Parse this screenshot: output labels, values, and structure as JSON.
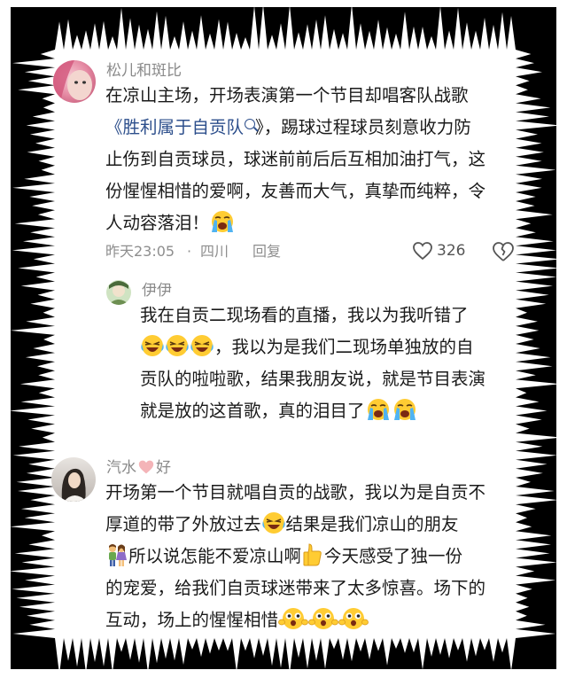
{
  "comments": [
    {
      "username": "松儿和斑比",
      "avatar": "avatar-pink-face",
      "lines": [
        [
          "在凉山主场，开场表演第一个节目却唱客队战歌"
        ],
        [
          "《胜利属于自贡队",
          "》，踢球过程球员刻意收力防"
        ],
        [
          "止伤到自贡球员，球迷前前后后互相加油打气，这"
        ],
        [
          "份惺惺相惜的爱啊，友善而大气，真挚而纯粹，令"
        ],
        [
          "人动容落泪！"
        ]
      ],
      "time": "昨天23:05",
      "separator": "·",
      "location": "四川",
      "reply_label": "回复",
      "like_count": "326",
      "reply": {
        "username": "伊伊",
        "avatar": "avatar-green",
        "lines": [
          [
            "我在自贡二现场看的直播，我以为我听错了"
          ],
          [
            "，我以为是我们二现场单独放的自"
          ],
          [
            "贡队的啦啦歌，结果我朋友说，就是节目表演"
          ],
          [
            "就是放的这首歌，真的泪目了"
          ]
        ]
      }
    },
    {
      "username_part1": "汽水",
      "username_part2": "好",
      "avatar": "avatar-girl-photo",
      "lines": [
        [
          "开场第一个节目就唱自贡的战歌，我以为是自贡不"
        ],
        [
          "厚道的带了外放过去",
          "结果是我们凉山的朋友"
        ],
        [
          "所以说怎能不爱凉山啊",
          "今天感受了独一份"
        ],
        [
          "的宠爱，给我们自贡球迷带来了太多惊喜。场下的"
        ],
        [
          "互动，场上的惺惺相惜"
        ]
      ]
    }
  ],
  "emoji": [
    "crying-face",
    "laugh-crying-face",
    "couple",
    "thumbs-up",
    "surprised-face"
  ],
  "colors": {
    "link": "#2d4f8c",
    "meta": "#8e8e8e",
    "text": "#1a1a1a",
    "heart": "#f4b4b8"
  }
}
